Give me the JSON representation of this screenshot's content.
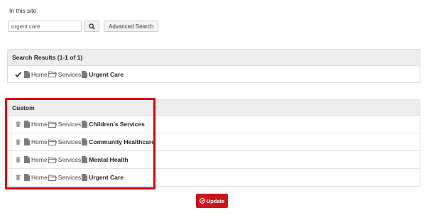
{
  "scope": {
    "label": "In this site"
  },
  "search": {
    "value": "urgent care",
    "advanced_label": "Advanced Search"
  },
  "results": {
    "header": "Search Results (1-1 of 1)",
    "rows": [
      {
        "selected": true,
        "path": [
          "Home",
          "Services"
        ],
        "leaf": "Urgent Care"
      }
    ]
  },
  "custom": {
    "header": "Custom",
    "rows": [
      {
        "path": [
          "Home",
          "Services"
        ],
        "leaf": "Children's Services"
      },
      {
        "path": [
          "Home",
          "Services"
        ],
        "leaf": "Community Healthcare"
      },
      {
        "path": [
          "Home",
          "Services"
        ],
        "leaf": "Mental Health"
      },
      {
        "path": [
          "Home",
          "Services"
        ],
        "leaf": "Urgent Care"
      }
    ]
  },
  "actions": {
    "update_label": "Update"
  },
  "colors": {
    "highlight": "#d80000",
    "update_bg": "#c9161c",
    "header_bg": "#eeeeee"
  },
  "icons": {
    "row_page": "page-icon",
    "row_folder": "folder-icon",
    "remove": "trash-icon",
    "check": "checkmark-icon",
    "search": "search-icon",
    "update": "circle-check-icon"
  }
}
